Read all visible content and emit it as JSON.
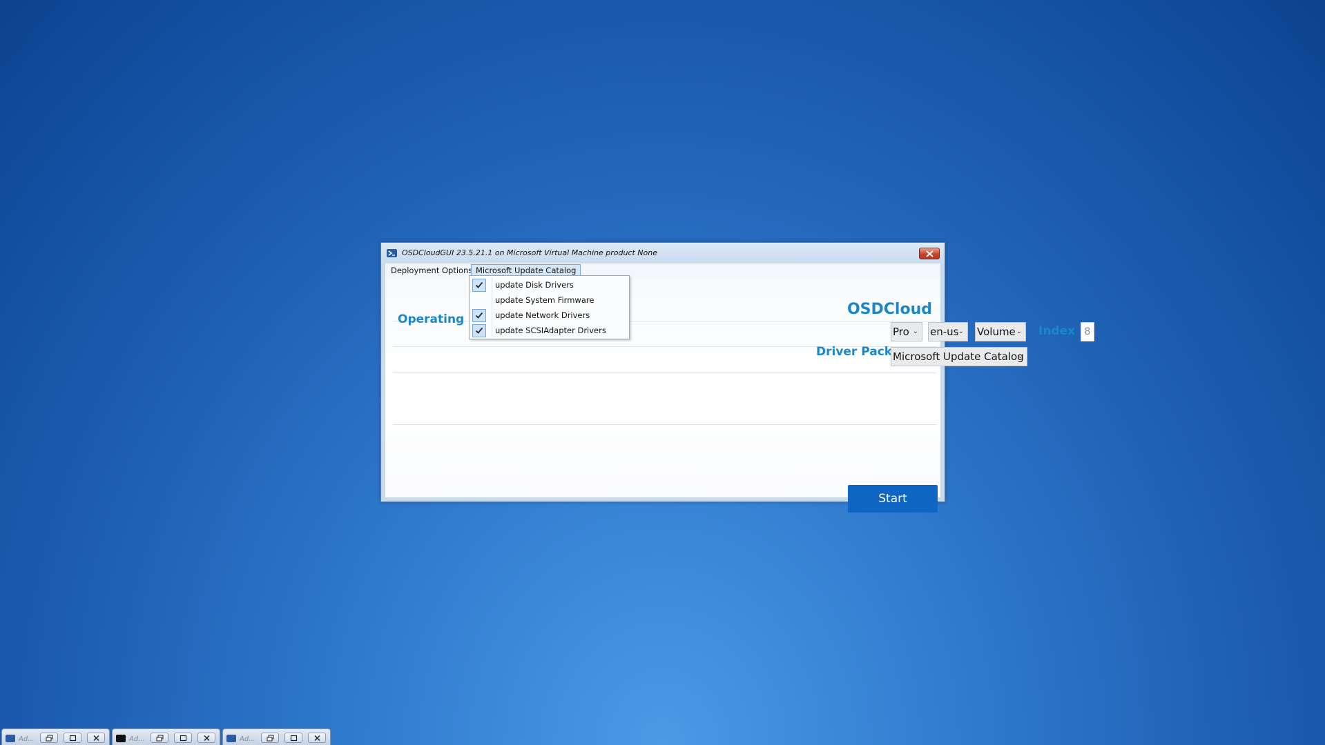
{
  "window": {
    "title": "OSDCloudGUI 23.5.21.1 on Microsoft Virtual Machine product None"
  },
  "menu": {
    "items": [
      "Deployment Options",
      "Microsoft Update Catalog"
    ]
  },
  "dropdown": {
    "items": [
      {
        "label": "update Disk Drivers",
        "checked": true
      },
      {
        "label": "update System Firmware",
        "checked": false
      },
      {
        "label": "update Network Drivers",
        "checked": true
      },
      {
        "label": "update SCSIAdapter Drivers",
        "checked": true
      }
    ]
  },
  "brand": "OSDCloud",
  "os_section": {
    "label": "Operating Sy",
    "edition": "Pro",
    "language": "en-us",
    "activation": "Volume",
    "index_label": "Index",
    "index_value": "8"
  },
  "driver_section": {
    "label": "Driver Pack",
    "value": "Microsoft Update Catalog"
  },
  "start_label": "Start",
  "taskbar": [
    {
      "title": "Ad...",
      "icon": "powershell-icon"
    },
    {
      "title": "Ad...",
      "icon": "cmd-icon"
    },
    {
      "title": "Ad...",
      "icon": "powershell-icon"
    }
  ],
  "colors": {
    "accent": "#1b87c9",
    "start_button": "#0f65c4",
    "desktop": "#2f78cc"
  }
}
